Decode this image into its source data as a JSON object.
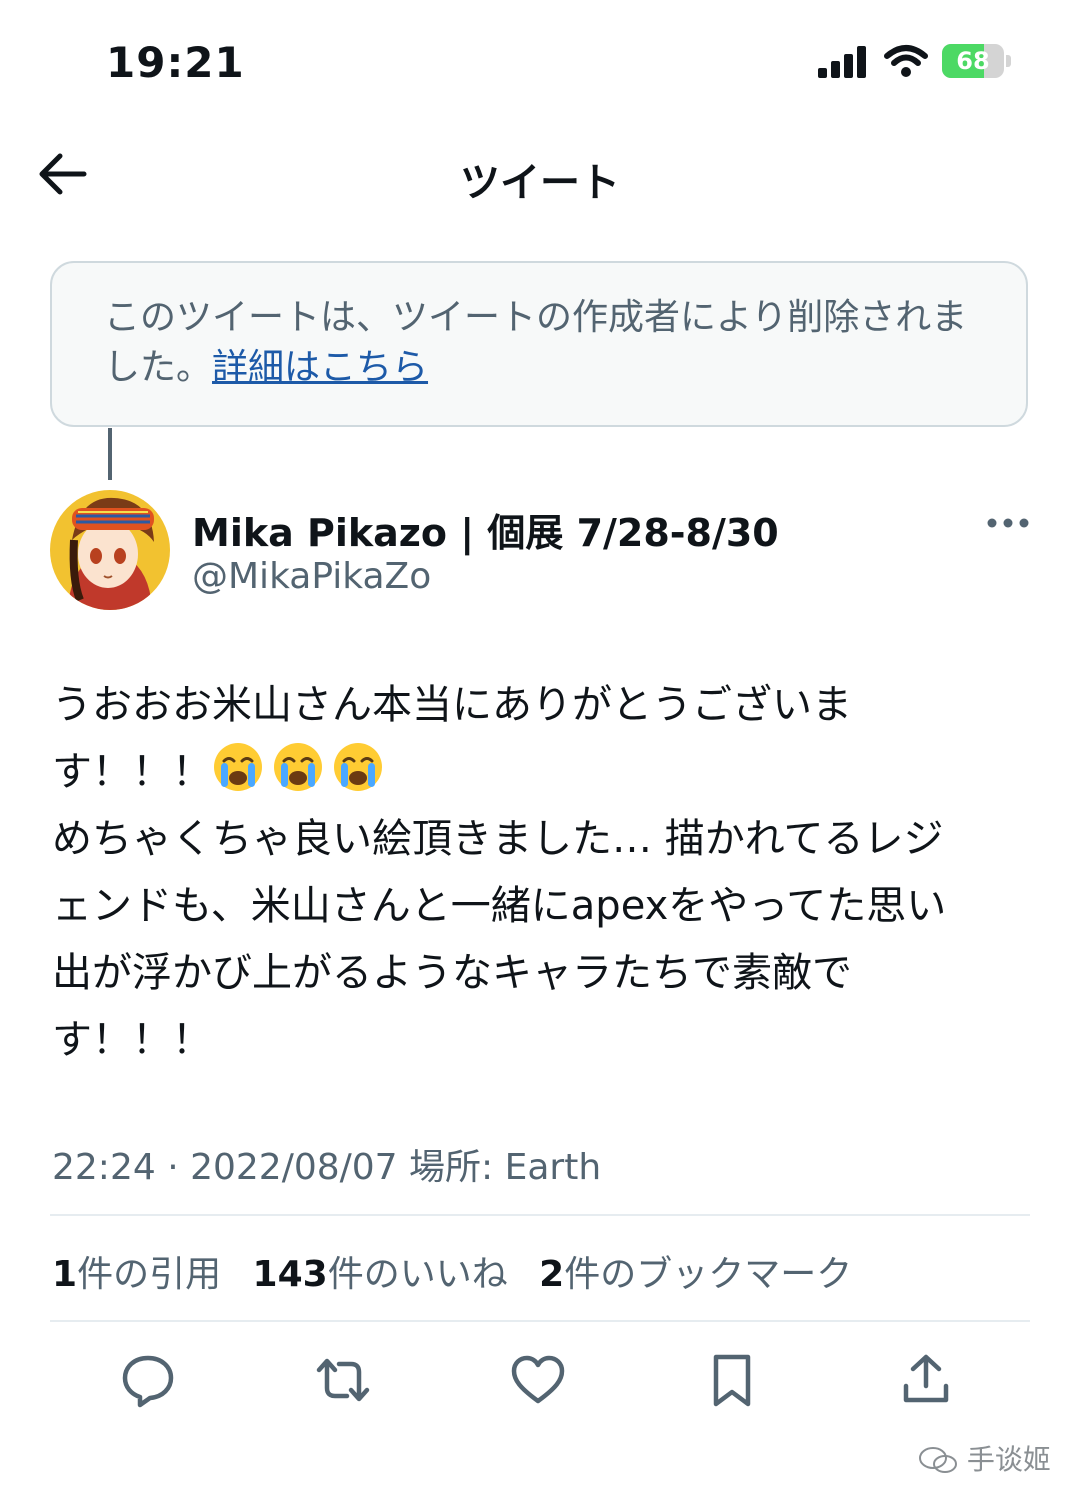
{
  "status_bar": {
    "time": "19:21",
    "battery_level": "68",
    "battery_fraction": 0.68,
    "icons": [
      "signal-icon",
      "wifi-icon",
      "battery-icon"
    ]
  },
  "nav": {
    "back_icon": "arrow-left-icon",
    "title": "ツイート"
  },
  "notice": {
    "text": "このツイートは、ツイートの作成者により削除されました。",
    "link": "詳細はこちら"
  },
  "author": {
    "display_name": "Mika Pikazo | 個展 7/28-8/30",
    "handle": "@MikaPikaZo",
    "more_icon": "more-icon"
  },
  "tweet": {
    "lines": [
      "うおおお米山さん本当にありがとうございま",
      "す！！！",
      "めちゃくちゃ良い絵頂きました… 描かれてるレジ",
      "ェンドも、米山さんと一緒にapexをやってた思い",
      "出が浮かび上がるようなキャラたちで素敵で",
      "す！！！"
    ],
    "emoji": [
      "loudly-crying-face",
      "loudly-crying-face",
      "loudly-crying-face"
    ]
  },
  "meta": {
    "time": "22:24",
    "separator": " · ",
    "date": "2022/08/07",
    "place_label": "場所: ",
    "place": "Earth"
  },
  "stats": {
    "quotes_count": "1",
    "quotes_label": "件の引用",
    "likes_count": "143",
    "likes_label": "件のいいね",
    "bookmarks_count": "2",
    "bookmarks_label": "件のブックマーク"
  },
  "actions": [
    "reply-icon",
    "retweet-icon",
    "like-icon",
    "bookmark-icon",
    "share-icon"
  ],
  "watermark": {
    "text": "手谈姬"
  },
  "colors": {
    "text": "#0f1419",
    "secondary": "#536471",
    "link": "#1d5aa8",
    "battery": "#4cd964"
  }
}
